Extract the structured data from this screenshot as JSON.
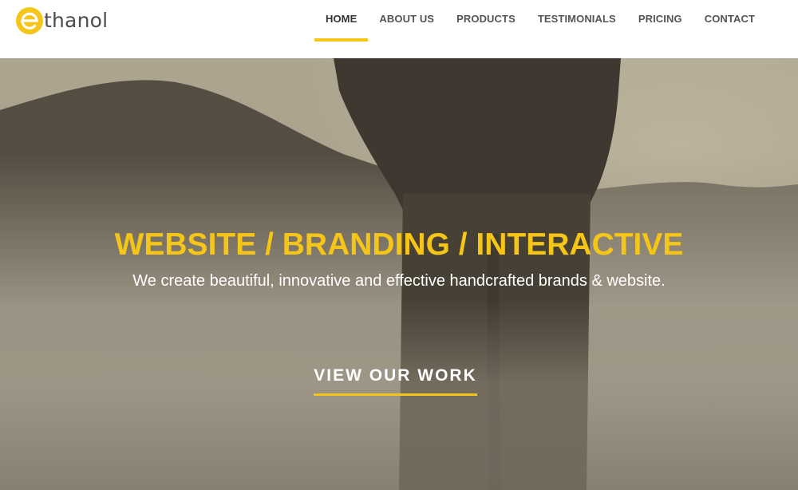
{
  "brand": {
    "logo_letter": "e",
    "logo_text": "thanol",
    "accent_color": "#f5c518"
  },
  "nav": {
    "items": [
      {
        "label": "HOME",
        "active": true
      },
      {
        "label": "ABOUT US",
        "active": false
      },
      {
        "label": "PRODUCTS",
        "active": false
      },
      {
        "label": "TESTIMONIALS",
        "active": false
      },
      {
        "label": "PRICING",
        "active": false
      },
      {
        "label": "CONTACT",
        "active": false
      }
    ]
  },
  "hero": {
    "headline": "WEBSITE / BRANDING / INTERACTIVE",
    "subline": "We create beautiful, innovative and effective handcrafted brands & website.",
    "cta_label": "VIEW OUR WORK",
    "background_image": "man-standing-in-misty-landscape"
  }
}
